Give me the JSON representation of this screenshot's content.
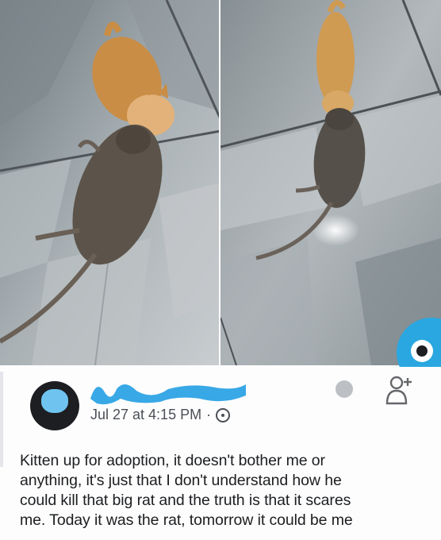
{
  "post": {
    "author_name": "",
    "timestamp": "Jul 27 at 4:15 PM",
    "separator": "·",
    "visibility_icon": "globe-icon",
    "badge_text": "",
    "text_lines": [
      "Kitten up for adoption, it doesn't bother me or",
      "anything, it's just that I don't understand how he",
      "could kill that big rat and the truth is that it scares",
      "me. Today it was the rat, tomorrow it could be me"
    ]
  },
  "photos": [
    {
      "name": "photo-kitten-rat-left",
      "description_icon": "photo"
    },
    {
      "name": "photo-kitten-rat-right",
      "description_icon": "photo"
    }
  ],
  "colors": {
    "floor_light": "#c7ccd0",
    "floor_dark": "#8f989d",
    "kitten": "#d99a4e",
    "rat": "#5a5148",
    "brand_blue": "#2aa7e0",
    "meta_text": "#4b4f56"
  },
  "icons": {
    "add_friend": "add-friend-icon",
    "messenger": "messenger-bubble-icon"
  }
}
